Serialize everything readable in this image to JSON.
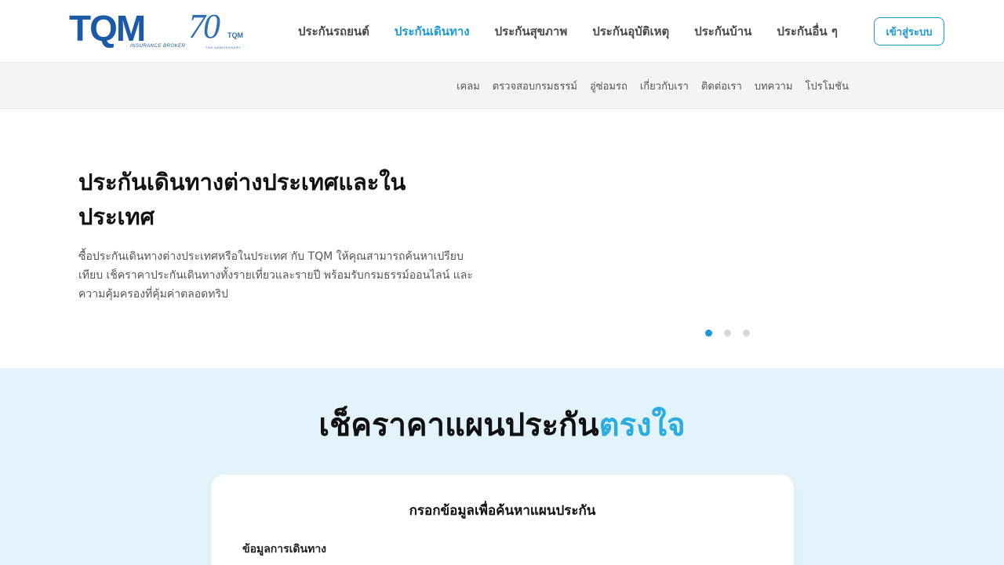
{
  "header": {
    "logo": {
      "brand": "TQM",
      "brand_sub": "INSURANCE BROKER",
      "anniversary_number": "70",
      "anniversary_brand": "TQM",
      "anniversary_sub": "70th ANNIVERSARY"
    },
    "nav": [
      {
        "label": "ประกันรถยนต์",
        "active": false
      },
      {
        "label": "ประกันเดินทาง",
        "active": true
      },
      {
        "label": "ประกันสุขภาพ",
        "active": false
      },
      {
        "label": "ประกันอุบัติเหตุ",
        "active": false
      },
      {
        "label": "ประกันบ้าน",
        "active": false
      },
      {
        "label": "ประกันอื่น ๆ",
        "active": false
      }
    ],
    "login_label": "เข้าสู่ระบบ"
  },
  "subnav": {
    "links": [
      "เคลม",
      "ตรวจสอบกรมธรรม์",
      "อู่ซ่อมรถ",
      "เกี่ยวกับเรา",
      "ติดต่อเรา",
      "บทความ",
      "โปรโมชัน"
    ]
  },
  "hero": {
    "title": "ประกันเดินทางต่างประเทศและในประเทศ",
    "description": "ซื้อประกันเดินทางต่างประเทศหรือในประเทศ กับ TQM ให้คุณสามารถค้นหาเปรียบเทียบ เช็คราคาประกันเดินทางทั้งรายเที่ยวและรายปี พร้อมรับกรมธรรม์ออนไลน์ และความคุ้มครองที่คุ้มค่าตลอดทริป",
    "carousel": {
      "slide_count": 3,
      "active_index": 0
    }
  },
  "search": {
    "heading_main": "เช็คราคาแผนประกัน",
    "heading_highlight": "ตรงใจ",
    "card_title": "กรอกข้อมูลเพื่อค้นหาแผนประกัน",
    "section_label": "ข้อมูลการเดินทาง"
  },
  "colors": {
    "brand_blue": "#1a5aa8",
    "accent": "#1a9ad6",
    "highlight": "#2aaee0",
    "section_bg": "#e3f3fb"
  }
}
